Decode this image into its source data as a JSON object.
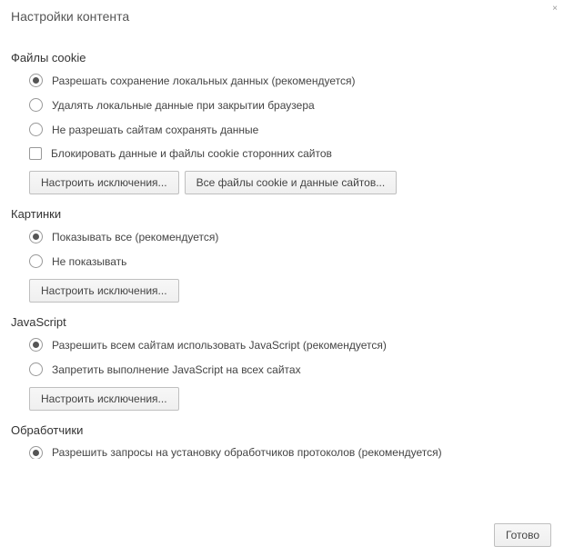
{
  "dialog": {
    "title": "Настройки контента",
    "close": "×"
  },
  "cookies": {
    "heading": "Файлы cookie",
    "options": [
      "Разрешать сохранение локальных данных (рекомендуется)",
      "Удалять локальные данные при закрытии браузера",
      "Не разрешать сайтам сохранять данные"
    ],
    "block_third_party": "Блокировать данные и файлы cookie сторонних сайтов",
    "manage_exceptions": "Настроить исключения...",
    "all_cookies": "Все файлы cookie и данные сайтов..."
  },
  "images": {
    "heading": "Картинки",
    "options": [
      "Показывать все (рекомендуется)",
      "Не показывать"
    ],
    "manage_exceptions": "Настроить исключения..."
  },
  "javascript": {
    "heading": "JavaScript",
    "options": [
      "Разрешить всем сайтам использовать JavaScript (рекомендуется)",
      "Запретить выполнение JavaScript на всех сайтах"
    ],
    "manage_exceptions": "Настроить исключения..."
  },
  "handlers": {
    "heading": "Обработчики",
    "options": [
      "Разрешить запросы на установку обработчиков протоколов (рекомендуется)"
    ]
  },
  "footer": {
    "done": "Готово"
  }
}
